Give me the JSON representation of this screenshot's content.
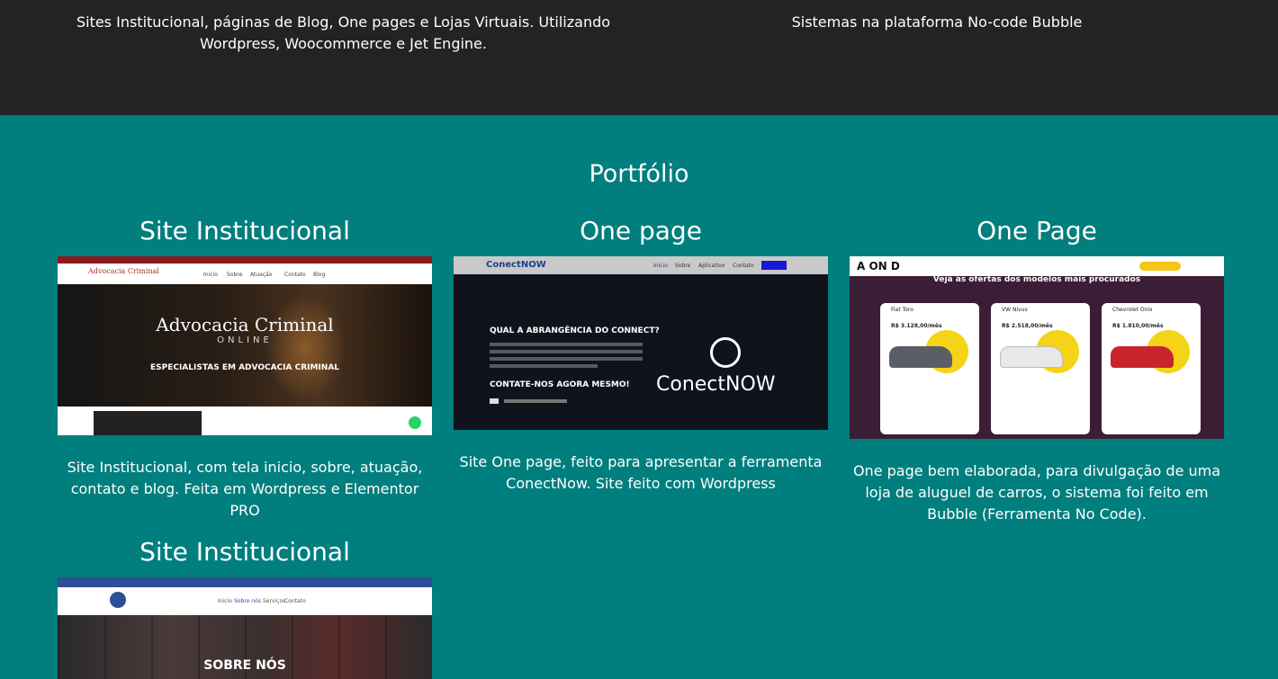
{
  "services": [
    {
      "text": "Sites Institucional, páginas de Blog, One pages e Lojas Virtuais. Utilizando Wordpress, Woocommerce e Jet Engine."
    },
    {
      "text": "Sistemas na plataforma No-code Bubble"
    }
  ],
  "portfolio": {
    "title": "Portfólio",
    "items": [
      {
        "title": "Site Institucional",
        "description": "Site Institucional, com tela inicio, sobre, atuação, contato e blog. Feita em Wordpress e Elementor PRO"
      },
      {
        "title": "One page",
        "description": "Site One page, feito para apresentar a ferramenta ConectNow. Site feito com Wordpress"
      },
      {
        "title": "One Page",
        "description": "One page bem elaborada, para divulgação de uma loja de aluguel de carros, o sistema foi feito em Bubble (Ferramenta No Code)."
      },
      {
        "title": "Site Institucional"
      }
    ]
  },
  "thumb1": {
    "logo": "Advocacia Criminal",
    "nav": [
      "Inicio",
      "Sobre",
      "Atuação",
      "Contato",
      "Blog"
    ],
    "hero_title": "Advocacia Criminal",
    "hero_sub": "ONLINE",
    "hero_tag": "ESPECIALISTAS EM ADVOCACIA CRIMINAL"
  },
  "thumb2": {
    "logo": "ConectNOW",
    "nav": [
      "Início",
      "Sobre",
      "Aplicativo",
      "Contato"
    ],
    "question": "QUAL A ABRANGÊNCIA DO CONNECT?",
    "cta": "CONTATE-NOS AGORA MESMO!",
    "brand": "ConectNOW"
  },
  "thumb3": {
    "logo": "A ON D",
    "headline": "Veja as ofertas dos modelos mais procurados",
    "cars": [
      {
        "name": "Fiat Toro",
        "price": "R$ 3.128,00/mês",
        "color": "#5a5f66"
      },
      {
        "name": "VW Nivus",
        "price": "R$ 2.518,00/mês",
        "color": "#eeeeee"
      },
      {
        "name": "Chevrolet Onix",
        "price": "R$ 1.810,00/mês",
        "color": "#c8242b"
      }
    ]
  },
  "thumb4": {
    "nav": [
      "Inicio",
      "Sobre nós",
      "Serviços",
      "Contato"
    ],
    "hero": "SOBRE NÓS"
  }
}
